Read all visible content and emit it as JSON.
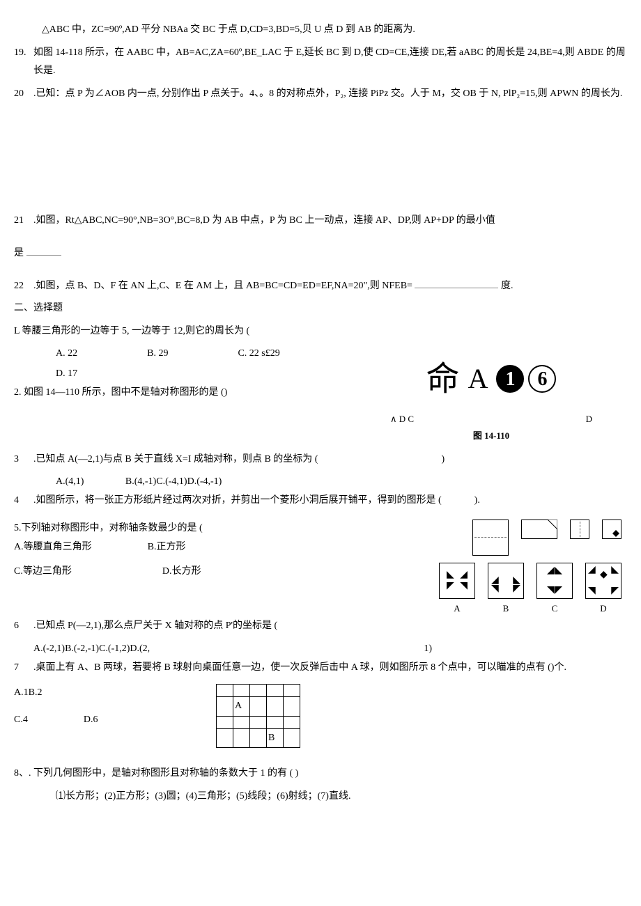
{
  "pre": {
    "line18b": "△ABC 中，ZC=90º,AD 平分 NBAa 交 BC 于点 D,CD=3,BD=5,贝 U 点 D 到 AB 的距离为.",
    "q19": "如图 14-118 所示，在 AABC 中，AB=AC,ZA=60º,BE_LAC 于 E,延长 BC 到 D,使 CD=CE,连接 DE,若 aABC 的周长是 24,BE=4,则 ABDE 的周长是.",
    "q20": ".已知：点 P 为∠AOB 内一点, 分别作出 P 点关于。4、。8 的对称点外，P₂, 连接 PiPz 交。人于 M，交 OB 于 N, PlP₂=15,则 APWN 的周长为.",
    "q21": ".如图，Rt△ABC,NC=90°,NB=3O°,BC=8,D 为 AB 中点，P 为 BC 上一动点，连接 AP、DP,则 AP+DP 的最小值",
    "q21tail": "是 ",
    "q22": ".如图，点 B、D、F 在 AN 上,C、E 在 AM 上，且 AB=BC=CD=ED=EF,NA=20\",则 NFEB= ",
    "q22tail": " 度."
  },
  "section2": "二、选择题",
  "mc": {
    "q1": {
      "stem": "L 等腰三角形的一边等于 5, 一边等于 12,则它的周长为 (",
      "A": "A. 22",
      "B": "B. 29",
      "C": "C. 22 s£29",
      "D": "D. 17"
    },
    "q2": {
      "stem": "2. 如图 14—110 所示，图中不是轴对称图形的是 ()",
      "figLine1": "命",
      "figA": "A",
      "figC1": "1",
      "figC2": "6",
      "figRow2L": "∧ D C",
      "figRow2R": "D",
      "caption": "图 14-110"
    },
    "q3": {
      "num": "3",
      "stem": ".已知点 A(—2,1)与点 B 关于直线 X=I 成轴对称，则点 B 的坐标为 (",
      "tail": ")",
      "opts": "A.(4,1)                 B.(4,-1)C.(-4,1)D.(-4,-1)"
    },
    "q4": {
      "num": "4",
      "stem": ".如图所示，将一张正方形纸片经过两次对折，并剪出一个菱形小洞后展开铺平，得到的图形是 (",
      "tail": ").",
      "labels": [
        "A",
        "B",
        "C",
        "D"
      ]
    },
    "q5": {
      "stem": "5.下列轴对称图形中，对称轴条数最少的是 (",
      "A": "A.等腰直角三角形",
      "B": "B.正方形",
      "C": "C.等边三角形",
      "D": "D.长方形"
    },
    "q6": {
      "num": "6",
      "stem": ".已知点 P(—2,1),那么点尸关于 X 轴对称的点 P'的坐标是 (",
      "optsL": "A.(-2,1)B.(-2,-1)C.(-1,2)D.(2,",
      "optsR": "1)"
    },
    "q7": {
      "num": "7",
      "stem": ".桌面上有 A、B 两球，若要将 B 球射向桌面任意一边，使一次反弹后击中 A 球，则如图所示 8 个点中，可以瞄准的点有 ()个.",
      "A": "A.1B.2",
      "C": "C.4",
      "D": "D.6",
      "gridA": "A",
      "gridB": "B"
    },
    "q8": {
      "stem": "8、. 下列几何图形中，是轴对称图形且对称轴的条数大于 1 的有 (            )",
      "sub": "⑴长方形；(2)正方形；(3)圆；(4)三角形；(5)线段；(6)射线；(7)直线."
    }
  }
}
